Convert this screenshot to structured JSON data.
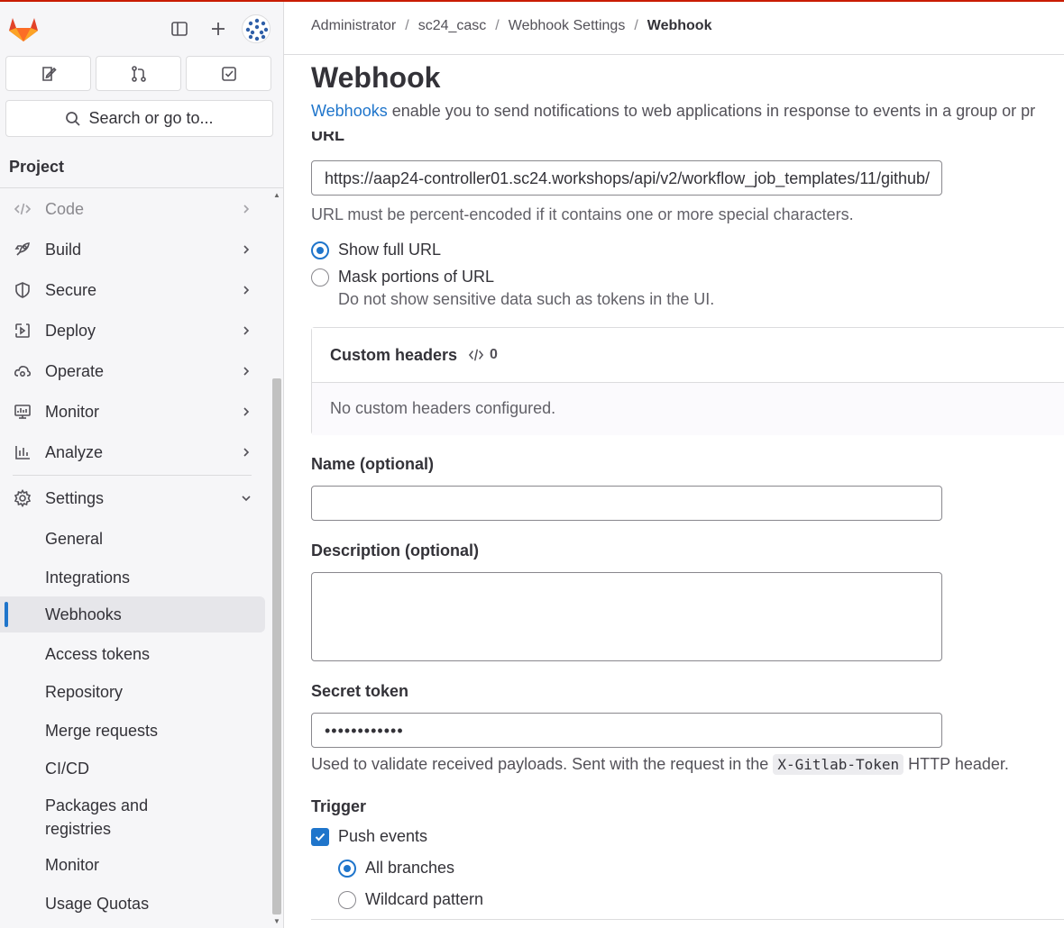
{
  "sidebar": {
    "search_label": "Search or go to...",
    "section_title": "Project",
    "nav": [
      {
        "label": "Code",
        "icon": "code-icon"
      },
      {
        "label": "Build",
        "icon": "rocket-icon"
      },
      {
        "label": "Secure",
        "icon": "shield-icon"
      },
      {
        "label": "Deploy",
        "icon": "deploy-icon"
      },
      {
        "label": "Operate",
        "icon": "cloud-gear-icon"
      },
      {
        "label": "Monitor",
        "icon": "monitor-icon"
      },
      {
        "label": "Analyze",
        "icon": "chart-icon"
      },
      {
        "label": "Settings",
        "icon": "gear-icon"
      }
    ],
    "settings_items": [
      {
        "label": "General"
      },
      {
        "label": "Integrations"
      },
      {
        "label": "Webhooks"
      },
      {
        "label": "Access tokens"
      },
      {
        "label": "Repository"
      },
      {
        "label": "Merge requests"
      },
      {
        "label": "CI/CD"
      },
      {
        "label": "Packages and registries"
      },
      {
        "label": "Monitor"
      },
      {
        "label": "Usage Quotas"
      }
    ]
  },
  "breadcrumb": [
    "Administrator",
    "sc24_casc",
    "Webhook Settings",
    "Webhook"
  ],
  "page": {
    "title": "Webhook",
    "intro_link": "Webhooks",
    "intro_text": " enable you to send notifications to web applications in response to events in a group or pr",
    "url_label": "URL",
    "url_value": "https://aap24-controller01.sc24.workshops/api/v2/workflow_job_templates/11/github/",
    "url_help": "URL must be percent-encoded if it contains one or more special characters.",
    "show_full_url": "Show full URL",
    "mask_url": "Mask portions of URL",
    "mask_help": "Do not show sensitive data such as tokens in the UI.",
    "custom_headers_title": "Custom headers",
    "custom_headers_count": "0",
    "custom_headers_empty": "No custom headers configured.",
    "name_label": "Name (optional)",
    "description_label": "Description (optional)",
    "secret_label": "Secret token",
    "secret_value": "••••••••••••",
    "secret_help_pre": "Used to validate received payloads. Sent with the request in the ",
    "secret_help_code": "X-Gitlab-Token",
    "secret_help_post": " HTTP header.",
    "trigger_label": "Trigger",
    "push_events": "Push events",
    "all_branches": "All branches",
    "wildcard": "Wildcard pattern"
  },
  "colors": {
    "accent": "#1f75cb",
    "brand_bar": "#c91c00"
  }
}
